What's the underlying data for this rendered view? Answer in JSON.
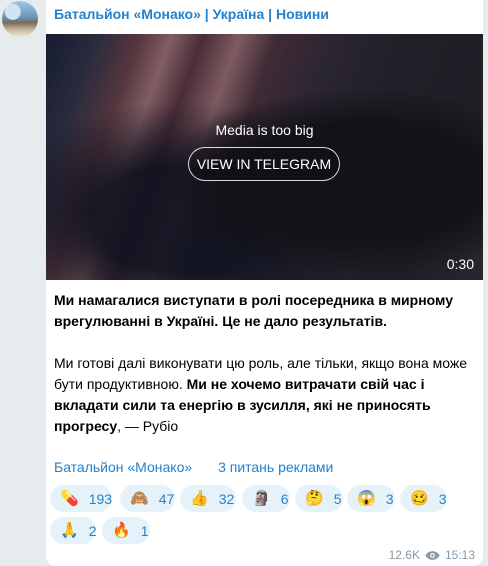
{
  "channel": {
    "title": "Батальйон «Монако» | Україна | Новини"
  },
  "media": {
    "message": "Media is too big",
    "button_label": "VIEW IN TELEGRAM",
    "duration": "0:30"
  },
  "post": {
    "p1": "Ми намагалися виступати в ролі посередника в мирному врегулюванні в Україні. Це не дало результатів.",
    "p2_regular": "Ми готові далі виконувати цю роль, але тільки, якщо вона може бути продуктивною. ",
    "p2_bold": "Ми не хочемо витрачати свій час і вкладати сили та енергію в зусилля, які не приносять прогресу",
    "p2_end": ", — Рубіо"
  },
  "links": {
    "channel": "Батальйон «Монако»",
    "ads": "3 питань реклами"
  },
  "reactions": [
    {
      "emoji": "💊",
      "count": "193",
      "icon": "pill-icon"
    },
    {
      "emoji": "🙈",
      "count": "47",
      "icon": "see-no-evil-monkey-icon"
    },
    {
      "emoji": "👍",
      "count": "32",
      "icon": "thumbs-up-icon"
    },
    {
      "emoji": "🗿",
      "count": "6",
      "icon": "moai-icon"
    },
    {
      "emoji": "🤔",
      "count": "5",
      "icon": "thinking-face-icon"
    },
    {
      "emoji": "😱",
      "count": "3",
      "icon": "screaming-face-icon"
    },
    {
      "emoji": "🥴",
      "count": "3",
      "icon": "woozy-face-icon"
    },
    {
      "emoji": "🙏",
      "count": "2",
      "icon": "folded-hands-icon"
    },
    {
      "emoji": "🔥",
      "count": "1",
      "icon": "fire-icon"
    }
  ],
  "footer": {
    "views": "12.6K",
    "time": "15:13"
  }
}
